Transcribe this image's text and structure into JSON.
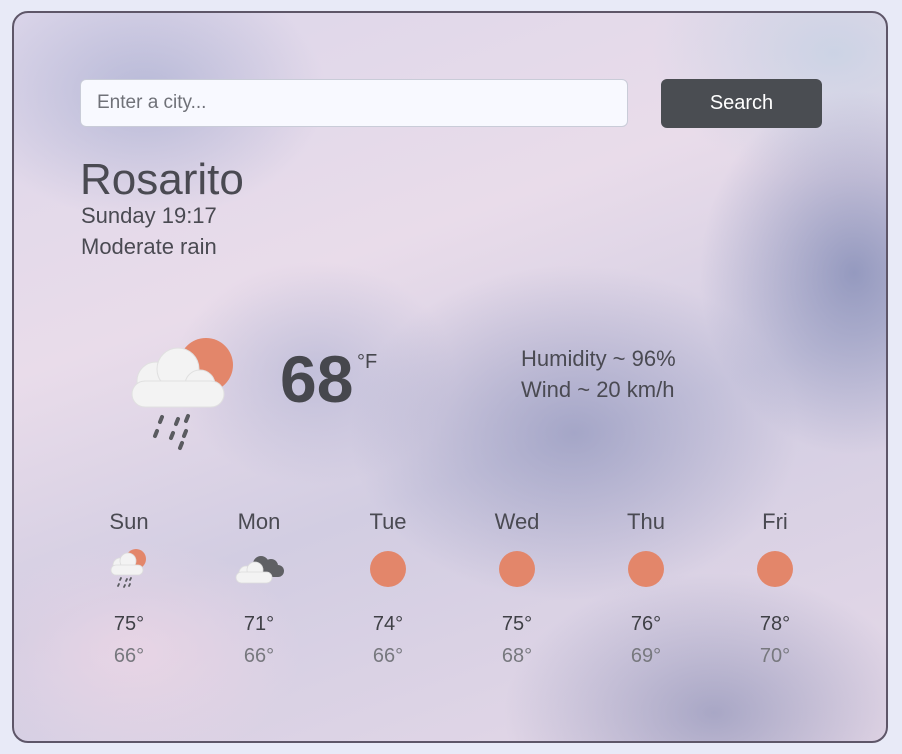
{
  "search": {
    "placeholder": "Enter a city...",
    "button_label": "Search"
  },
  "current": {
    "city": "Rosarito",
    "datetime": "Sunday 19:17",
    "condition": "Moderate rain",
    "temperature": "68",
    "unit": "°F",
    "humidity": "Humidity ~ 96%",
    "wind": "Wind ~ 20 km/h",
    "icon": "sun-cloud-rain-icon"
  },
  "forecast": [
    {
      "day": "Sun",
      "high": "75°",
      "low": "66°",
      "icon": "sun-cloud-rain-icon"
    },
    {
      "day": "Mon",
      "high": "71°",
      "low": "66°",
      "icon": "cloudy-icon"
    },
    {
      "day": "Tue",
      "high": "74°",
      "low": "66°",
      "icon": "sun-icon"
    },
    {
      "day": "Wed",
      "high": "75°",
      "low": "68°",
      "icon": "sun-icon"
    },
    {
      "day": "Thu",
      "high": "76°",
      "low": "69°",
      "icon": "sun-icon"
    },
    {
      "day": "Fri",
      "high": "78°",
      "low": "70°",
      "icon": "sun-icon"
    }
  ],
  "colors": {
    "sun": "#e3866a",
    "cloud": "#f2f2f2",
    "dark_cloud": "#5f6064",
    "button": "#4a4d52"
  }
}
